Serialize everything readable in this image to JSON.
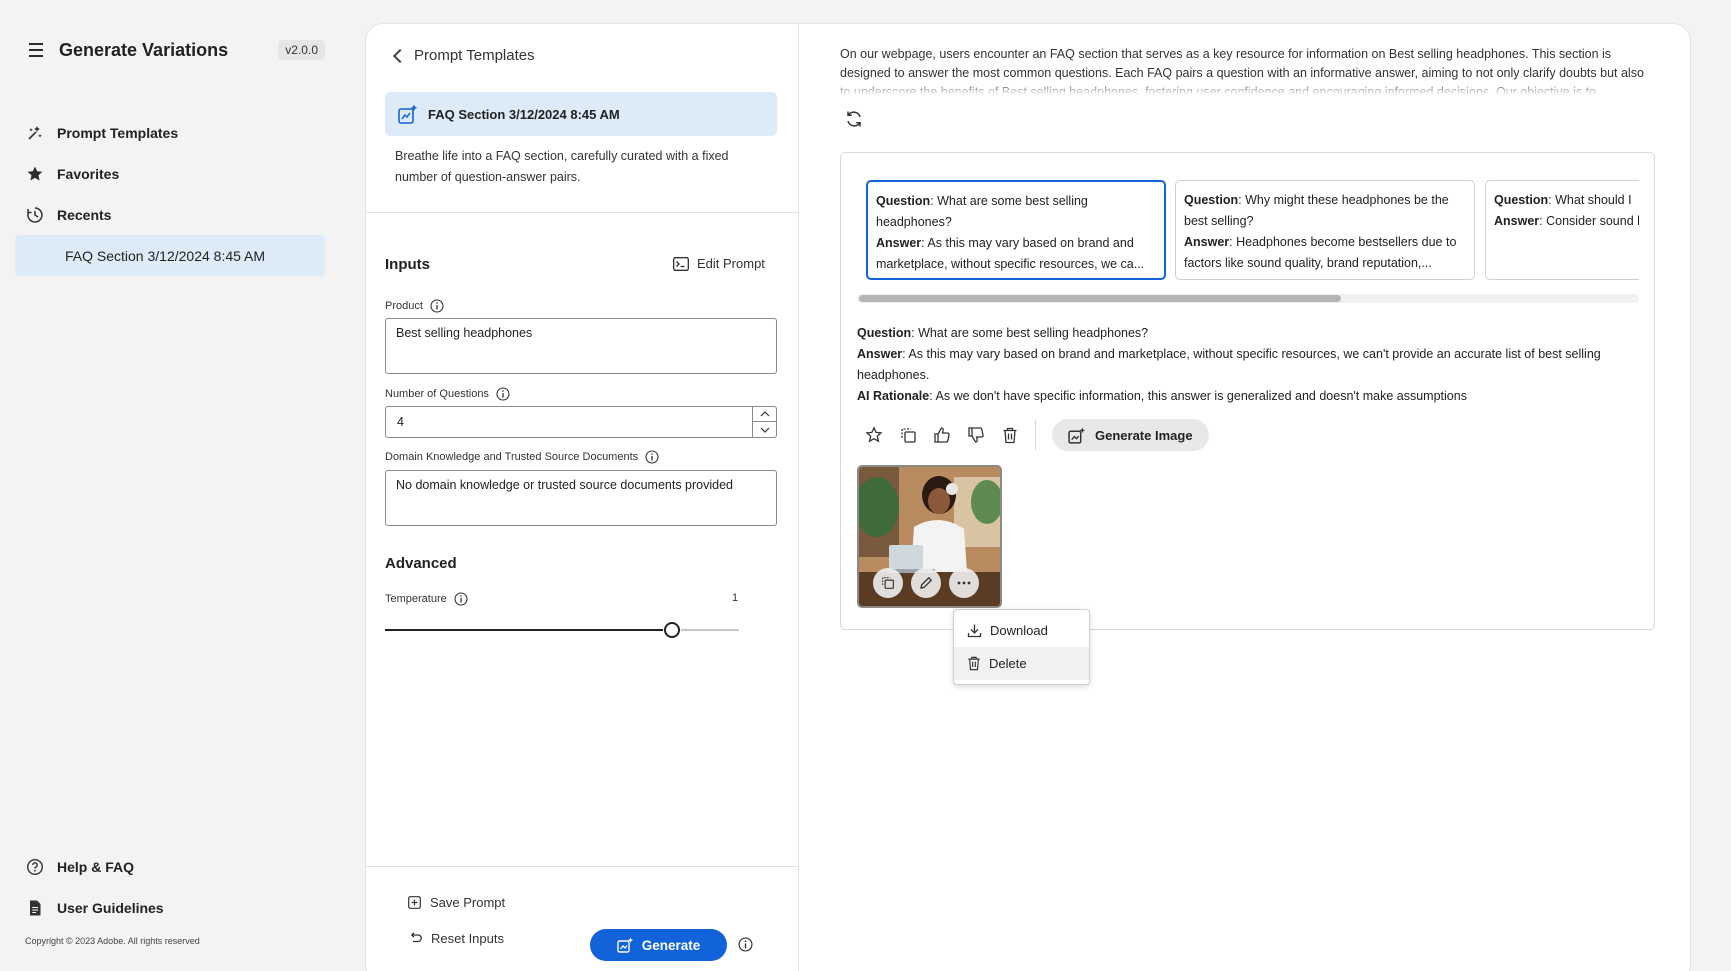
{
  "app": {
    "title": "Generate Variations",
    "version": "v2.0.0"
  },
  "sidebar": {
    "items": [
      {
        "label": "Prompt Templates",
        "icon": "prompt-templates-icon"
      },
      {
        "label": "Favorites",
        "icon": "star-icon"
      },
      {
        "label": "Recents",
        "icon": "history-icon"
      }
    ],
    "recent_active": "FAQ Section 3/12/2024 8:45 AM",
    "bottom": [
      {
        "label": "Help & FAQ",
        "icon": "help-icon"
      },
      {
        "label": "User Guidelines",
        "icon": "document-icon"
      }
    ],
    "copyright": "Copyright © 2023 Adobe. All rights reserved"
  },
  "left_pane": {
    "back_label": "Prompt Templates",
    "template_name": "FAQ Section 3/12/2024 8:45 AM",
    "template_description": "Breathe life into a FAQ section, carefully curated with a fixed number of question-answer pairs.",
    "inputs_title": "Inputs",
    "edit_prompt_label": "Edit Prompt",
    "product_label": "Product",
    "product_value": "Best selling headphones",
    "num_questions_label": "Number of Questions",
    "num_questions_value": "4",
    "domain_label": "Domain Knowledge and Trusted Source Documents",
    "domain_value": "No domain knowledge or trusted source documents provided",
    "advanced_title": "Advanced",
    "temperature_label": "Temperature",
    "temperature_value": "1",
    "temperature_fraction": 0.81,
    "save_prompt_label": "Save Prompt",
    "reset_inputs_label": "Reset Inputs",
    "generate_label": "Generate"
  },
  "right_pane": {
    "intro_text": "On our webpage, users encounter an FAQ section that serves as a key resource for information on Best selling headphones. This section is designed to answer the most common questions. Each FAQ pairs a question with an informative answer, aiming to not only clarify doubts but also to underscore the benefits of Best selling headphones, fostering user confidence and encouraging informed decisions. Our objective is to",
    "question_prefix": "Question",
    "answer_prefix": "Answer",
    "rationale_prefix": "AI Rationale",
    "cards": [
      {
        "question": "What are some best selling headphones?",
        "answer": "As this may vary based on brand and marketplace, without specific resources, we ca..."
      },
      {
        "question": "Why might these headphones be the best selling?",
        "answer": "Headphones become bestsellers due to factors like sound quality, brand reputation,..."
      },
      {
        "question": "What should I",
        "answer": "Consider sound brand reputation, custom"
      }
    ],
    "detail": {
      "question": "What are some best selling headphones?",
      "answer": "As this may vary based on brand and marketplace, without specific resources, we can't provide an accurate list of best selling headphones.",
      "rationale": "As we don't have specific information, this answer is generalized and doesn't make assumptions"
    },
    "generate_image_label": "Generate Image",
    "menu": {
      "download": "Download",
      "delete": "Delete"
    }
  },
  "colors": {
    "accent": "#1262d9",
    "selected_bg": "#dcebf7"
  }
}
